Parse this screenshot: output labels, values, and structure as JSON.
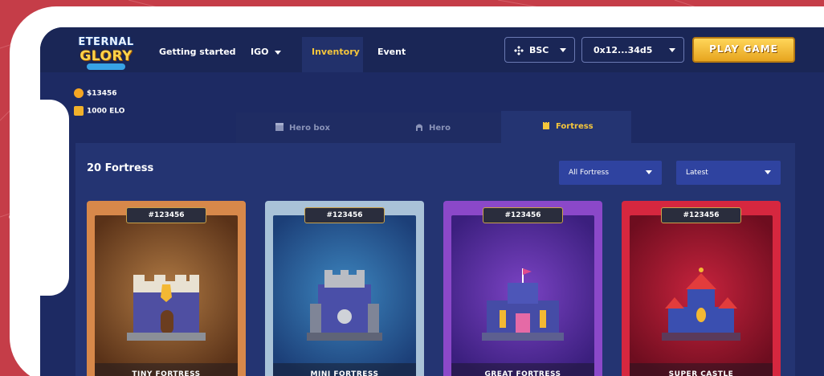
{
  "brand": {
    "logo_line1": "ETERNAL",
    "logo_line2": "GLORY"
  },
  "nav": {
    "items": [
      {
        "label": "Getting started"
      },
      {
        "label": "IGO"
      },
      {
        "label": "Inventory"
      },
      {
        "label": "Event"
      }
    ]
  },
  "network_select": {
    "value": "BSC"
  },
  "wallet_select": {
    "value": "0x12...34d5"
  },
  "play_button": {
    "label": "PLAY GAME"
  },
  "balances": {
    "token": "$13456",
    "elo": "1000 ELO"
  },
  "tabs": [
    {
      "label": "Hero box"
    },
    {
      "label": "Hero"
    },
    {
      "label": "Fortress"
    }
  ],
  "panel": {
    "title": "20 Fortress"
  },
  "filters": {
    "type": "All Fortress",
    "sort": "Latest"
  },
  "cards": [
    {
      "id": "#123456",
      "name": "TINY FORTRESS"
    },
    {
      "id": "#123456",
      "name": "MINI FORTRESS"
    },
    {
      "id": "#123456",
      "name": "GREAT FORTRESS"
    },
    {
      "id": "#123456",
      "name": "SUPER CASTLE"
    }
  ],
  "colors": {
    "background": "#c53d48",
    "app_bg": "#1d2a63",
    "accent_gold": "#f5c63b",
    "card_tiny": "#d7884a",
    "card_mini": "#a9c2d8",
    "card_great": "#8b48c9",
    "card_super": "#d6273f"
  },
  "icons": [
    "network-icon",
    "chevron-down-icon",
    "coin-icon",
    "elo-icon",
    "hero-box-icon",
    "hero-icon",
    "fortress-icon"
  ]
}
